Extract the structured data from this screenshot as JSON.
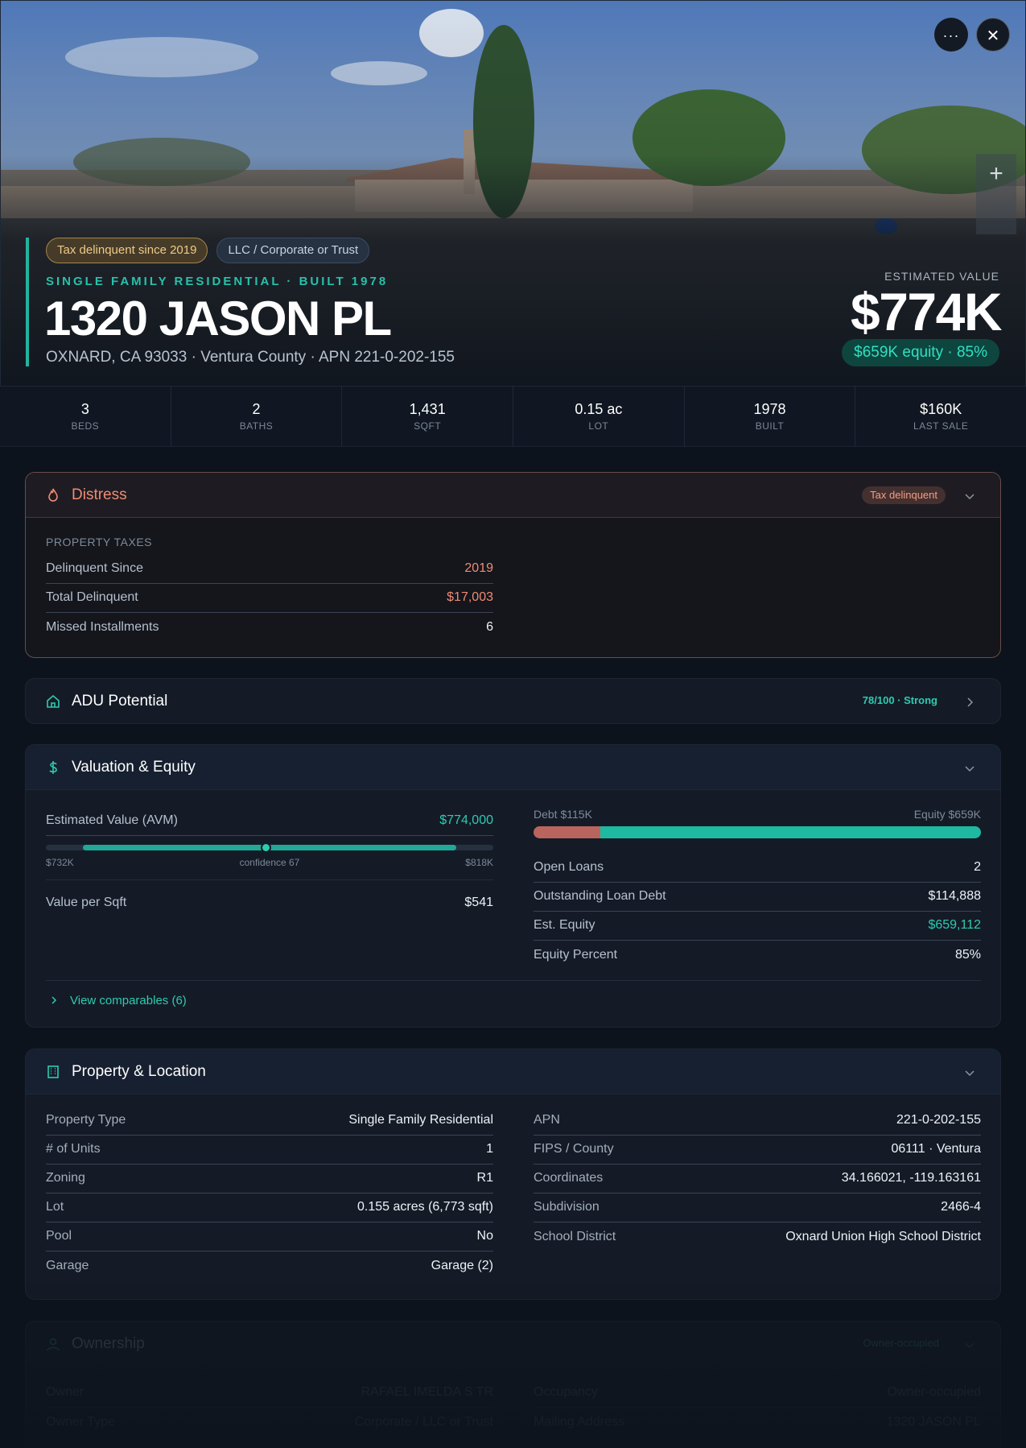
{
  "hero": {
    "tags": [
      "Tax delinquent since 2019",
      "LLC / Corporate or Trust"
    ],
    "subtitle": "SINGLE FAMILY RESIDENTIAL · BUILT 1978",
    "title": "1320 JASON PL",
    "location": "OXNARD, CA 93033 · Ventura County · APN 221-0-202-155",
    "est_label": "ESTIMATED VALUE",
    "est_value": "$774K",
    "equity_pill": "$659K equity · 85%",
    "more_icon": "···",
    "close_icon": "✕",
    "zoom_in": "+"
  },
  "stats": [
    {
      "value": "3",
      "label": "BEDS"
    },
    {
      "value": "2",
      "label": "BATHS"
    },
    {
      "value": "1,431",
      "label": "SQFT"
    },
    {
      "value": "0.15 ac",
      "label": "LOT"
    },
    {
      "value": "1978",
      "label": "BUILT"
    },
    {
      "value": "$160K",
      "label": "LAST SALE"
    }
  ],
  "distress": {
    "title": "Distress",
    "badge": "Tax delinquent",
    "section": "PROPERTY TAXES",
    "rows": [
      {
        "k": "Delinquent Since",
        "v": "2019"
      },
      {
        "k": "Total Delinquent",
        "v": "$17,003"
      },
      {
        "k": "Missed Installments",
        "v": "6"
      }
    ]
  },
  "adu": {
    "title": "ADU Potential",
    "score": "78/100 · Strong"
  },
  "valuation": {
    "title": "Valuation & Equity",
    "avm_label": "Estimated Value (AVM)",
    "avm_value": "$774,000",
    "avm_low": "$732K",
    "avm_confidence": "confidence 67",
    "avm_high": "$818K",
    "avm_range_low": 732000,
    "avm_range_high": 818000,
    "avm_point": 774000,
    "value_per_sqft_label": "Value per Sqft",
    "value_per_sqft": "$541",
    "debt_label": "Debt $115K",
    "equity_label": "Equity $659K",
    "debt": 115000,
    "equity": 659000,
    "rows": [
      {
        "k": "Open Loans",
        "v": "2"
      },
      {
        "k": "Outstanding Loan Debt",
        "v": "$114,888"
      },
      {
        "k": "Est. Equity",
        "v": "$659,112"
      },
      {
        "k": "Equity Percent",
        "v": "85%"
      }
    ],
    "comparables": "View comparables (6)"
  },
  "property": {
    "title": "Property & Location",
    "left": [
      {
        "k": "Property Type",
        "v": "Single Family Residential"
      },
      {
        "k": "# of Units",
        "v": "1"
      },
      {
        "k": "Zoning",
        "v": "R1"
      },
      {
        "k": "Lot",
        "v": "0.155 acres (6,773 sqft)"
      },
      {
        "k": "Pool",
        "v": "No"
      },
      {
        "k": "Garage",
        "v": "Garage (2)"
      }
    ],
    "right": [
      {
        "k": "APN",
        "v": "221-0-202-155"
      },
      {
        "k": "FIPS / County",
        "v": "06111 · Ventura"
      },
      {
        "k": "Coordinates",
        "v": "34.166021, -119.163161"
      },
      {
        "k": "Subdivision",
        "v": "2466-4"
      },
      {
        "k": "School District",
        "v": "Oxnard Union High School District"
      }
    ]
  },
  "ownership": {
    "title": "Ownership",
    "badge": "Owner-occupied",
    "left": [
      {
        "k": "Owner",
        "v": "RAFAEL IMELDA S TR"
      },
      {
        "k": "Owner Type",
        "v": "Corporate / LLC or Trust"
      }
    ],
    "right": [
      {
        "k": "Occupancy",
        "v": "Owner-occupied"
      },
      {
        "k": "Mailing Address",
        "v": "1320 JASON PL"
      }
    ]
  },
  "colors": {
    "accent": "#2ecbb0",
    "distress": "#f08b73",
    "background": "#0d131c"
  }
}
